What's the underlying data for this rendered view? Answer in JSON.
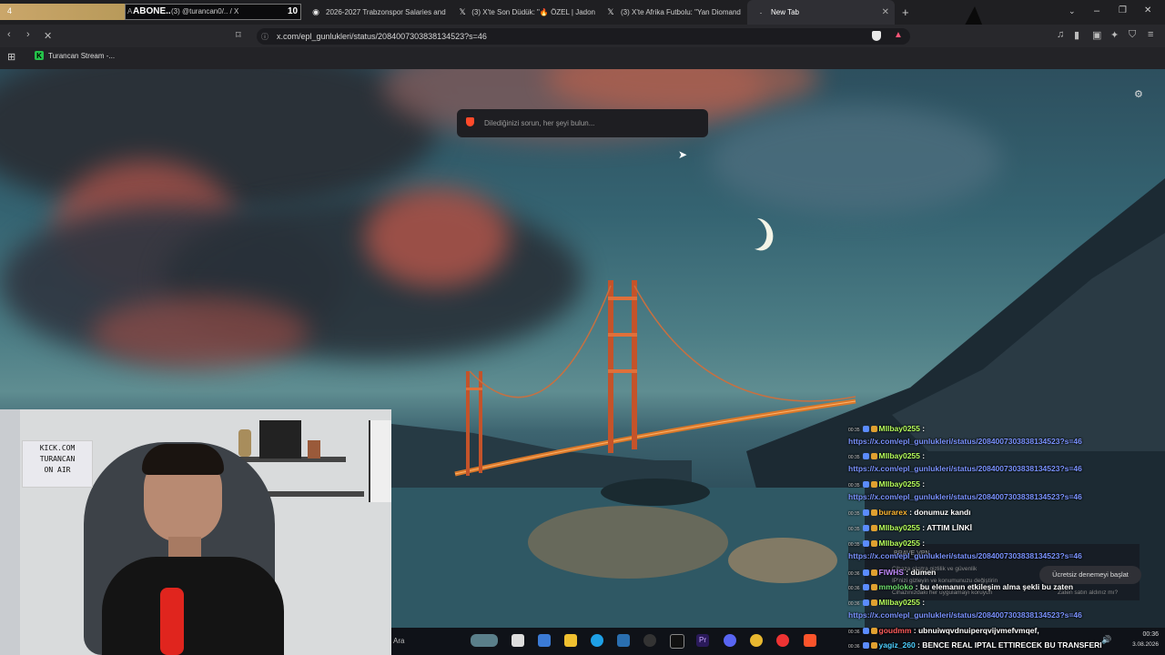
{
  "overlay": {
    "left_number": "4",
    "aa": "A",
    "abone": "ABONE..",
    "handle": "(3) @turancan0/.. / X",
    "count": "10"
  },
  "tabs": [
    {
      "label": "2026-2027 Trabzonspor Salaries and",
      "icon": "eye-icon"
    },
    {
      "label": "(3) X'te Son Düdük: \"🔥 ÖZEL | Jadon",
      "icon": "x-icon"
    },
    {
      "label": "(3) X'te Afrika Futbolu: \"Yan Diomand",
      "icon": "x-icon"
    },
    {
      "label": "New Tab",
      "icon": "loading-icon"
    }
  ],
  "toolbar": {
    "url": "x.com/epl_gunlukleri/status/2084007303838134523?s=46"
  },
  "bookmarks": [
    {
      "label": "Turancan Stream -..."
    }
  ],
  "newtab": {
    "search_placeholder": "Dilediğinizi sorun, her şeyi bulun..."
  },
  "webcam": {
    "sign_lines": [
      "KICK.COM",
      "TURANCAN",
      "ON AIR"
    ]
  },
  "chat": {
    "lines": [
      {
        "time": "00:35",
        "user": "MIlbay0255",
        "msg": "",
        "user_color": "#b6ff5c"
      },
      {
        "time": "",
        "user": "",
        "msg": "https://x.com/epl_gunlukleri/status/2084007303838134523?s=46",
        "link": true
      },
      {
        "time": "00:35",
        "user": "MIlbay0255",
        "msg": "",
        "user_color": "#b6ff5c"
      },
      {
        "time": "",
        "user": "",
        "msg": "https://x.com/epl_gunlukleri/status/2084007303838134523?s=46",
        "link": true
      },
      {
        "time": "00:35",
        "user": "MIlbay0255",
        "msg": "",
        "user_color": "#b6ff5c"
      },
      {
        "time": "",
        "user": "",
        "msg": "https://x.com/epl_gunlukleri/status/2084007303838134523?s=46",
        "link": true
      },
      {
        "time": "00:35",
        "user": "burarex",
        "msg": "donumuz kandı",
        "user_color": "#ffb833"
      },
      {
        "time": "00:35",
        "user": "MIlbay0255",
        "msg": "ATTIM LİNKİ",
        "user_color": "#b6ff5c"
      },
      {
        "time": "00:35",
        "user": "MIlbay0255",
        "msg": "",
        "user_color": "#b6ff5c"
      },
      {
        "time": "",
        "user": "",
        "msg": "https://x.com/epl_gunlukleri/status/2084007303838134523?s=46",
        "link": true
      },
      {
        "time": "00:36",
        "user": "FIWHS",
        "msg": "dümen",
        "user_color": "#c38bff"
      },
      {
        "time": "00:36",
        "user": "mmoloko",
        "msg": "bu elemanın etkileşim alma şekli bu zaten",
        "user_color": "#6fe06f"
      },
      {
        "time": "00:36",
        "user": "MIlbay0255",
        "msg": "",
        "user_color": "#b6ff5c"
      },
      {
        "time": "",
        "user": "",
        "msg": "https://x.com/epl_gunlukleri/status/2084007303838134523?s=46",
        "link": true
      },
      {
        "time": "00:36",
        "user": "goudmm",
        "msg": "ubnuiwqvdnuiperqvijvmefvmqef,",
        "user_color": "#ff5c5c"
      },
      {
        "time": "00:36",
        "user": "yagiz_260",
        "msg": "BENCE REAL IPTAL ETTIRECEK BU TRANSFERI",
        "user_color": "#4ccfff"
      }
    ]
  },
  "vpn_popup": {
    "title": "BRAVE VPN",
    "line1": "Cihaza ekstra gizlilik ve güvenlik",
    "line2": "IP'nizi gizleyin ve konumunuzu değiştirin",
    "line3": "Cihazınızdaki her uygulamayı koruyun",
    "button": "Ücretsiz denemeyi başlat",
    "link": "Zaten satın aldınız mı?"
  },
  "taskbar": {
    "search": "Ara",
    "time": "00:36",
    "date": "3.08.2026"
  },
  "colors": {
    "accent": "#7a93ff",
    "brand_yellow": "#f0d000"
  }
}
